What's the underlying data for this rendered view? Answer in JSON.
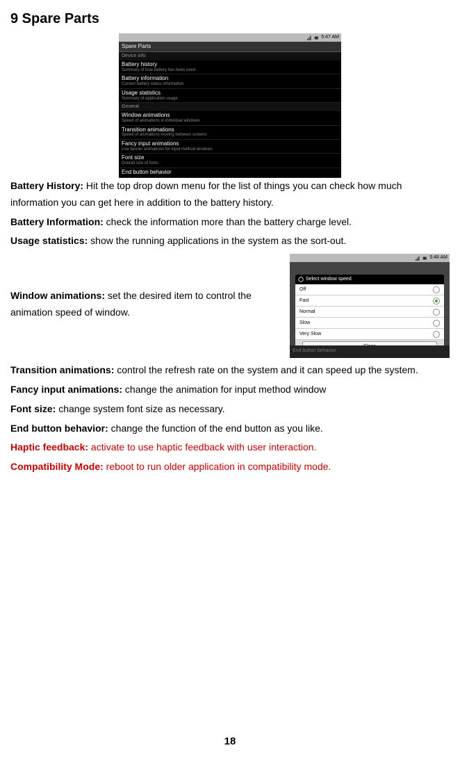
{
  "heading": "9 Spare Parts",
  "screenshot1": {
    "status_time": "5:47 AM",
    "title": "Spare Parts",
    "section1": "Device info",
    "items1": [
      {
        "t": "Battery history",
        "d": "Summary of how battery has been used"
      },
      {
        "t": "Battery information",
        "d": "Current battery status information"
      },
      {
        "t": "Usage statistics",
        "d": "Summary of application usage"
      }
    ],
    "section2": "General",
    "items2": [
      {
        "t": "Window animations",
        "d": "Speed of animations in individual windows"
      },
      {
        "t": "Transition animations",
        "d": "Speed of animations moving between screens"
      },
      {
        "t": "Fancy input animations",
        "d": "Use fancier animations for input method windows"
      },
      {
        "t": "Font size",
        "d": "Overall size of fonts"
      },
      {
        "t": "End button behavior",
        "d": ""
      }
    ]
  },
  "defs": {
    "battery_history_label": "Battery History:",
    "battery_history_text": " Hit the top drop down menu for the list of things you can check how much information you can get here in addition to the battery history.",
    "battery_info_label": "Battery Information:",
    "battery_info_text": " check the information more than the battery charge level.",
    "usage_label": "Usage statistics:",
    "usage_text": " show the running applications in the system as the sort-out.",
    "window_label": "Window animations:",
    "window_text": " set the desired item to control the animation speed of window.",
    "transition_label": "Transition animations:",
    "transition_text": " control the refresh rate on the system and it can speed up the system.",
    "fancy_label": "Fancy input animations:",
    "fancy_text": " change the animation for input method window",
    "font_label": "Font size:",
    "font_text": " change system font size as necessary.",
    "end_label": "End button behavior:",
    "end_text": " change the function of the end button as you like.",
    "haptic_label": "Haptic feedback:",
    "haptic_text": " activate to use haptic feedback with user interaction.",
    "compat_label": "Compatibility Mode:",
    "compat_text": " reboot to run older application in compatibility mode."
  },
  "screenshot2": {
    "status_time": "5:48 AM",
    "dialog_title": "Select window speed",
    "options": [
      "Off",
      "Fast",
      "Normal",
      "Slow",
      "Very Slow"
    ],
    "selected_index": 1,
    "close_label": "Close",
    "bottom_text": "End button behavior"
  },
  "page_number": "18"
}
